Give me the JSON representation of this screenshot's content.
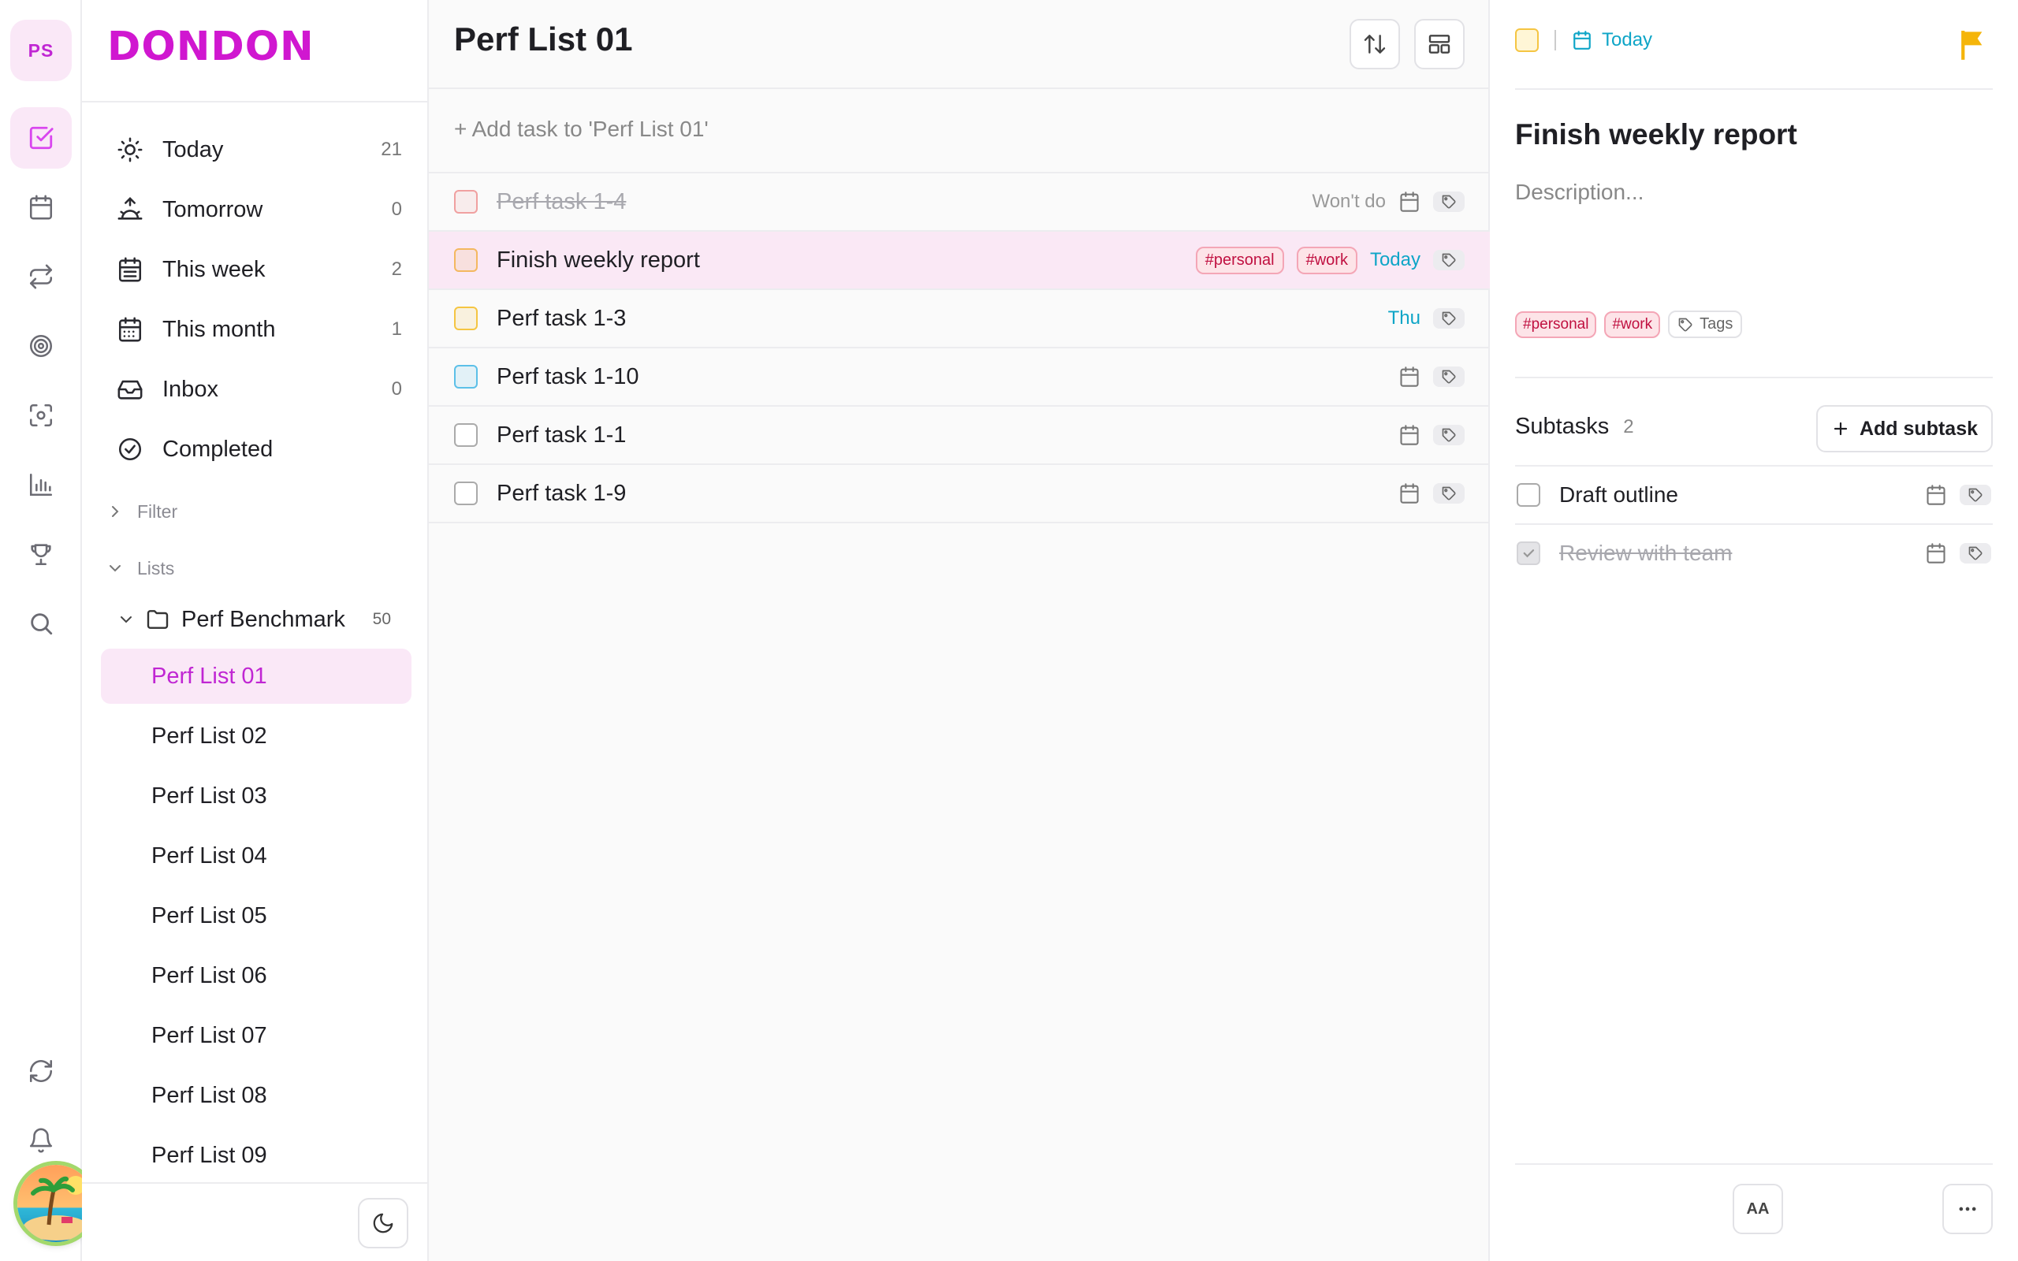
{
  "rail": {
    "avatar": "PS",
    "items": [
      "tasks-icon",
      "calendar-icon",
      "repeat-icon",
      "target-icon",
      "focus-icon",
      "stats-icon",
      "trophy-icon",
      "search-icon"
    ],
    "bottom": [
      "sync-icon",
      "bell-icon"
    ]
  },
  "sidebar": {
    "brand": "DONDON",
    "nav": [
      {
        "label": "Today",
        "count": "21"
      },
      {
        "label": "Tomorrow",
        "count": "0"
      },
      {
        "label": "This week",
        "count": "2"
      },
      {
        "label": "This month",
        "count": "1"
      },
      {
        "label": "Inbox",
        "count": "0"
      },
      {
        "label": "Completed",
        "count": ""
      }
    ],
    "filter_label": "Filter",
    "lists_label": "Lists",
    "folder": {
      "name": "Perf Benchmark",
      "count": "50"
    },
    "lists": [
      "Perf List 01",
      "Perf List 02",
      "Perf List 03",
      "Perf List 04",
      "Perf List 05",
      "Perf List 06",
      "Perf List 07",
      "Perf List 08",
      "Perf List 09"
    ],
    "active_list": "Perf List 01"
  },
  "main": {
    "title": "Perf List 01",
    "add_placeholder": "+ Add task to 'Perf List 01'",
    "tasks": [
      {
        "title": "Perf task 1-4",
        "done": true,
        "status": "Won't do",
        "tags": [],
        "date": "",
        "color": "#f0a0a0"
      },
      {
        "title": "Finish weekly report",
        "done": false,
        "status": "",
        "tags": [
          "#personal",
          "#work"
        ],
        "date": "Today",
        "color": "#f4b860"
      },
      {
        "title": "Perf task 1-3",
        "done": false,
        "status": "",
        "tags": [],
        "date": "Thu",
        "color": "#f5c542"
      },
      {
        "title": "Perf task 1-10",
        "done": false,
        "status": "",
        "tags": [],
        "date": "",
        "color": "#5cc0e8"
      },
      {
        "title": "Perf task 1-1",
        "done": false,
        "status": "",
        "tags": [],
        "date": "",
        "color": "#aaaaaa"
      },
      {
        "title": "Perf task 1-9",
        "done": false,
        "status": "",
        "tags": [],
        "date": "",
        "color": "#aaaaaa"
      }
    ]
  },
  "detail": {
    "date": "Today",
    "title": "Finish weekly report",
    "description_placeholder": "Description...",
    "tags": [
      "#personal",
      "#work"
    ],
    "tags_button": "Tags",
    "subtasks_label": "Subtasks",
    "subtasks_count": "2",
    "add_subtask": "Add subtask",
    "subtasks": [
      {
        "title": "Draft outline",
        "done": false
      },
      {
        "title": "Review with team",
        "done": true
      }
    ],
    "font_button": "AA",
    "colors": {
      "priority": "#f5b50a",
      "accent": "#d946ef",
      "date": "#0ea5c7"
    }
  }
}
